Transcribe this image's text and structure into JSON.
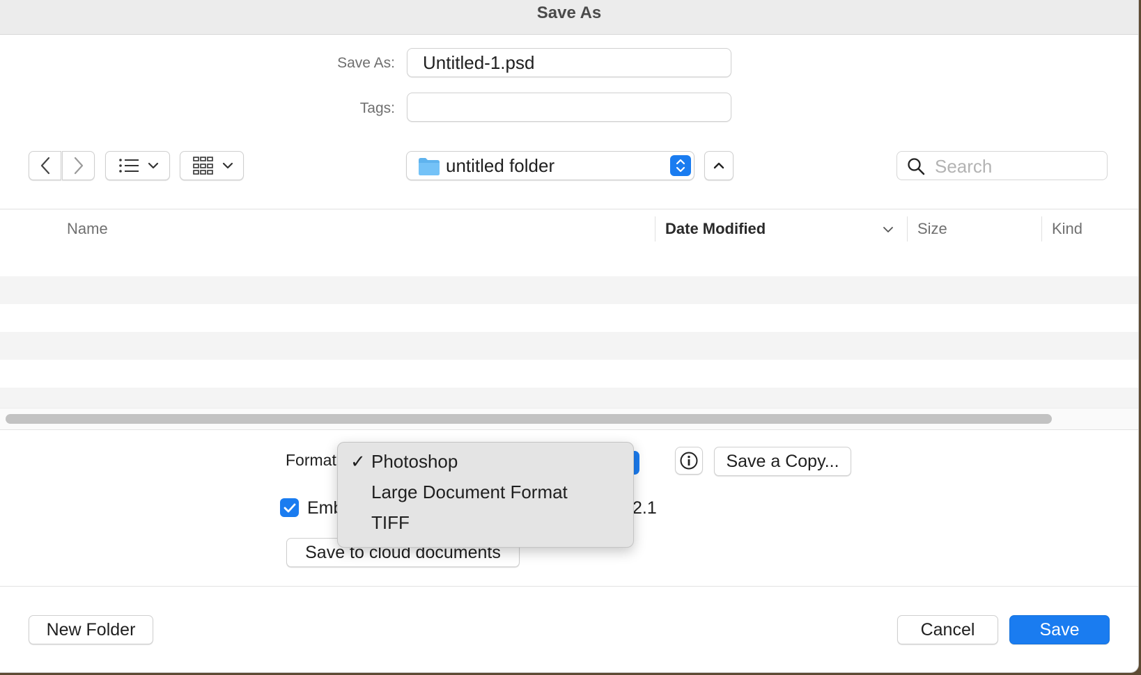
{
  "window": {
    "title": "Save As"
  },
  "form": {
    "save_as_label": "Save As:",
    "save_as_value": "Untitled-1.psd",
    "tags_label": "Tags:",
    "tags_value": ""
  },
  "toolbar": {
    "location": "untitled folder",
    "search_placeholder": "Search"
  },
  "list": {
    "columns": [
      "Name",
      "Date Modified",
      "Size",
      "Kind"
    ],
    "sorted_column": "Date Modified",
    "rows": []
  },
  "options": {
    "format_label": "Format",
    "format_selected": "Photoshop",
    "embed_label": "Emb",
    "embed_checked": true,
    "embed_suffix": "2.1",
    "cloud_button": "Save to cloud documents",
    "save_copy_button": "Save a Copy..."
  },
  "format_menu": {
    "items": [
      {
        "label": "Photoshop",
        "checked": true
      },
      {
        "label": "Large Document Format",
        "checked": false
      },
      {
        "label": "TIFF",
        "checked": false
      }
    ]
  },
  "footer": {
    "new_folder": "New Folder",
    "cancel": "Cancel",
    "save": "Save"
  },
  "colors": {
    "accent": "#1a7cf0",
    "row_alt": "#f4f4f4"
  }
}
